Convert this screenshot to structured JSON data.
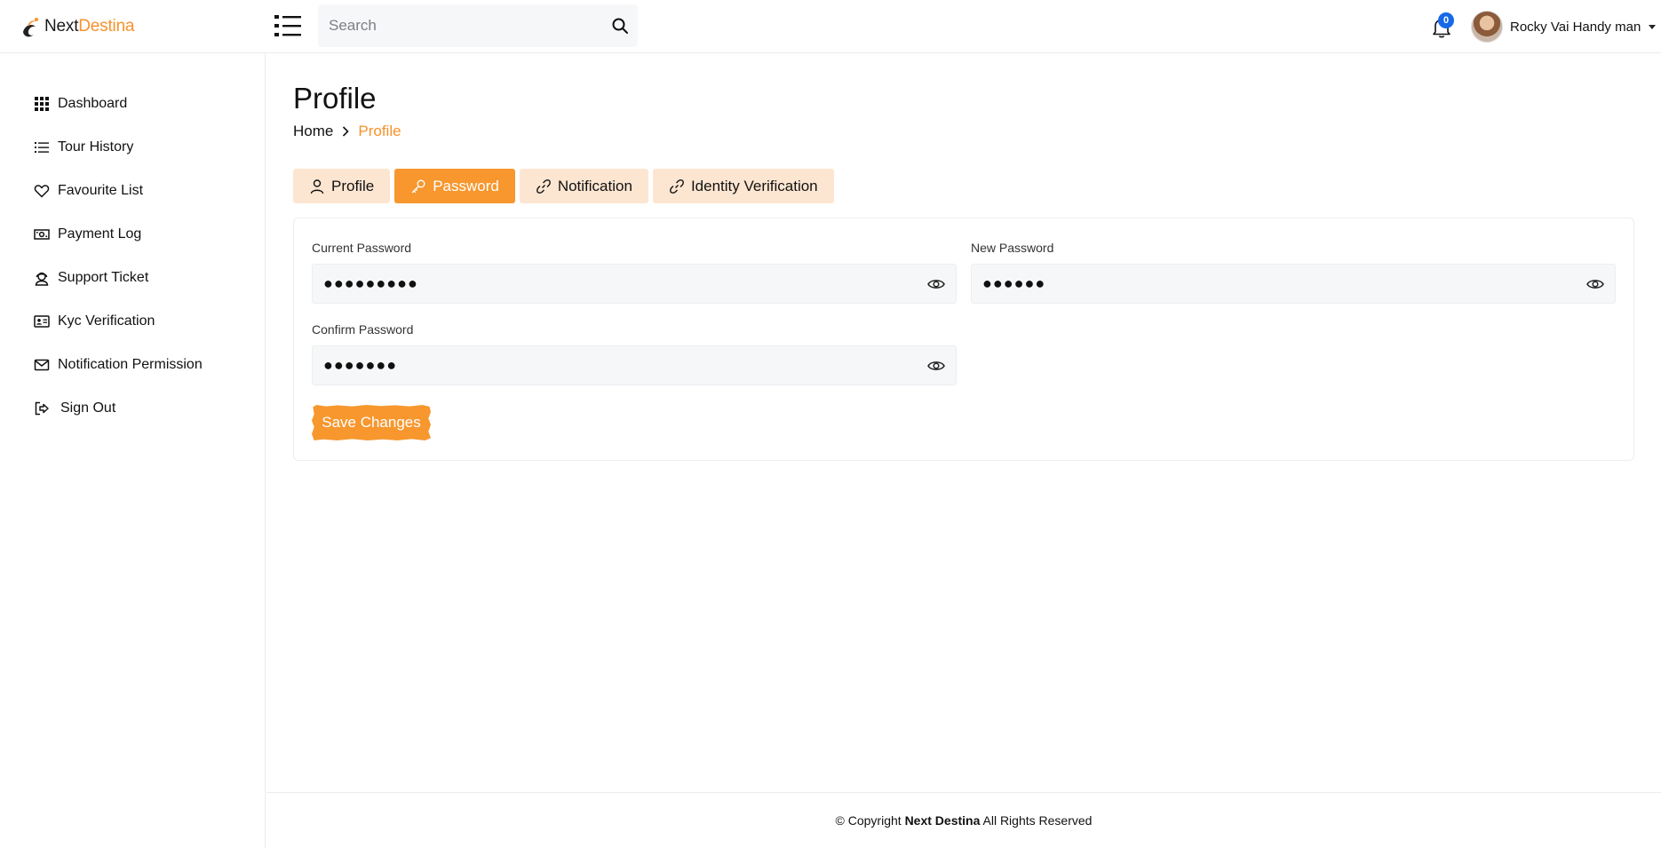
{
  "brand": {
    "name_part1": "Next",
    "name_part2": "Destina",
    "accent": "#f7922b"
  },
  "header": {
    "search_placeholder": "Search",
    "notification_count": "0",
    "user_name": "Rocky Vai Handy man"
  },
  "sidebar": {
    "items": [
      {
        "label": "Dashboard",
        "icon": "grid-icon"
      },
      {
        "label": "Tour History",
        "icon": "list-icon"
      },
      {
        "label": "Favourite List",
        "icon": "heart-icon"
      },
      {
        "label": "Payment Log",
        "icon": "money-icon"
      },
      {
        "label": "Support Ticket",
        "icon": "support-icon"
      },
      {
        "label": "Kyc Verification",
        "icon": "id-card-icon"
      },
      {
        "label": "Notification Permission",
        "icon": "envelope-icon"
      },
      {
        "label": "Sign Out",
        "icon": "sign-out-icon"
      }
    ]
  },
  "page": {
    "title": "Profile",
    "breadcrumb_home": "Home",
    "breadcrumb_current": "Profile"
  },
  "tabs": [
    {
      "label": "Profile",
      "icon": "user-icon",
      "active": false
    },
    {
      "label": "Password",
      "icon": "key-icon",
      "active": true
    },
    {
      "label": "Notification",
      "icon": "link-icon",
      "active": false
    },
    {
      "label": "Identity Verification",
      "icon": "link-icon",
      "active": false
    }
  ],
  "form": {
    "current_password_label": "Current Password",
    "current_password_value": "●●●●●●●●●",
    "new_password_label": "New Password",
    "new_password_value": "●●●●●●",
    "confirm_password_label": "Confirm Password",
    "confirm_password_value": "●●●●●●●",
    "save_label": "Save Changes"
  },
  "footer": {
    "prefix": "© Copyright",
    "company": "Next Destina",
    "suffix": "All Rights Reserved"
  },
  "colors": {
    "accent": "#f7972e",
    "tab_inactive_bg": "#fde6d1",
    "badge": "#1769e8"
  }
}
